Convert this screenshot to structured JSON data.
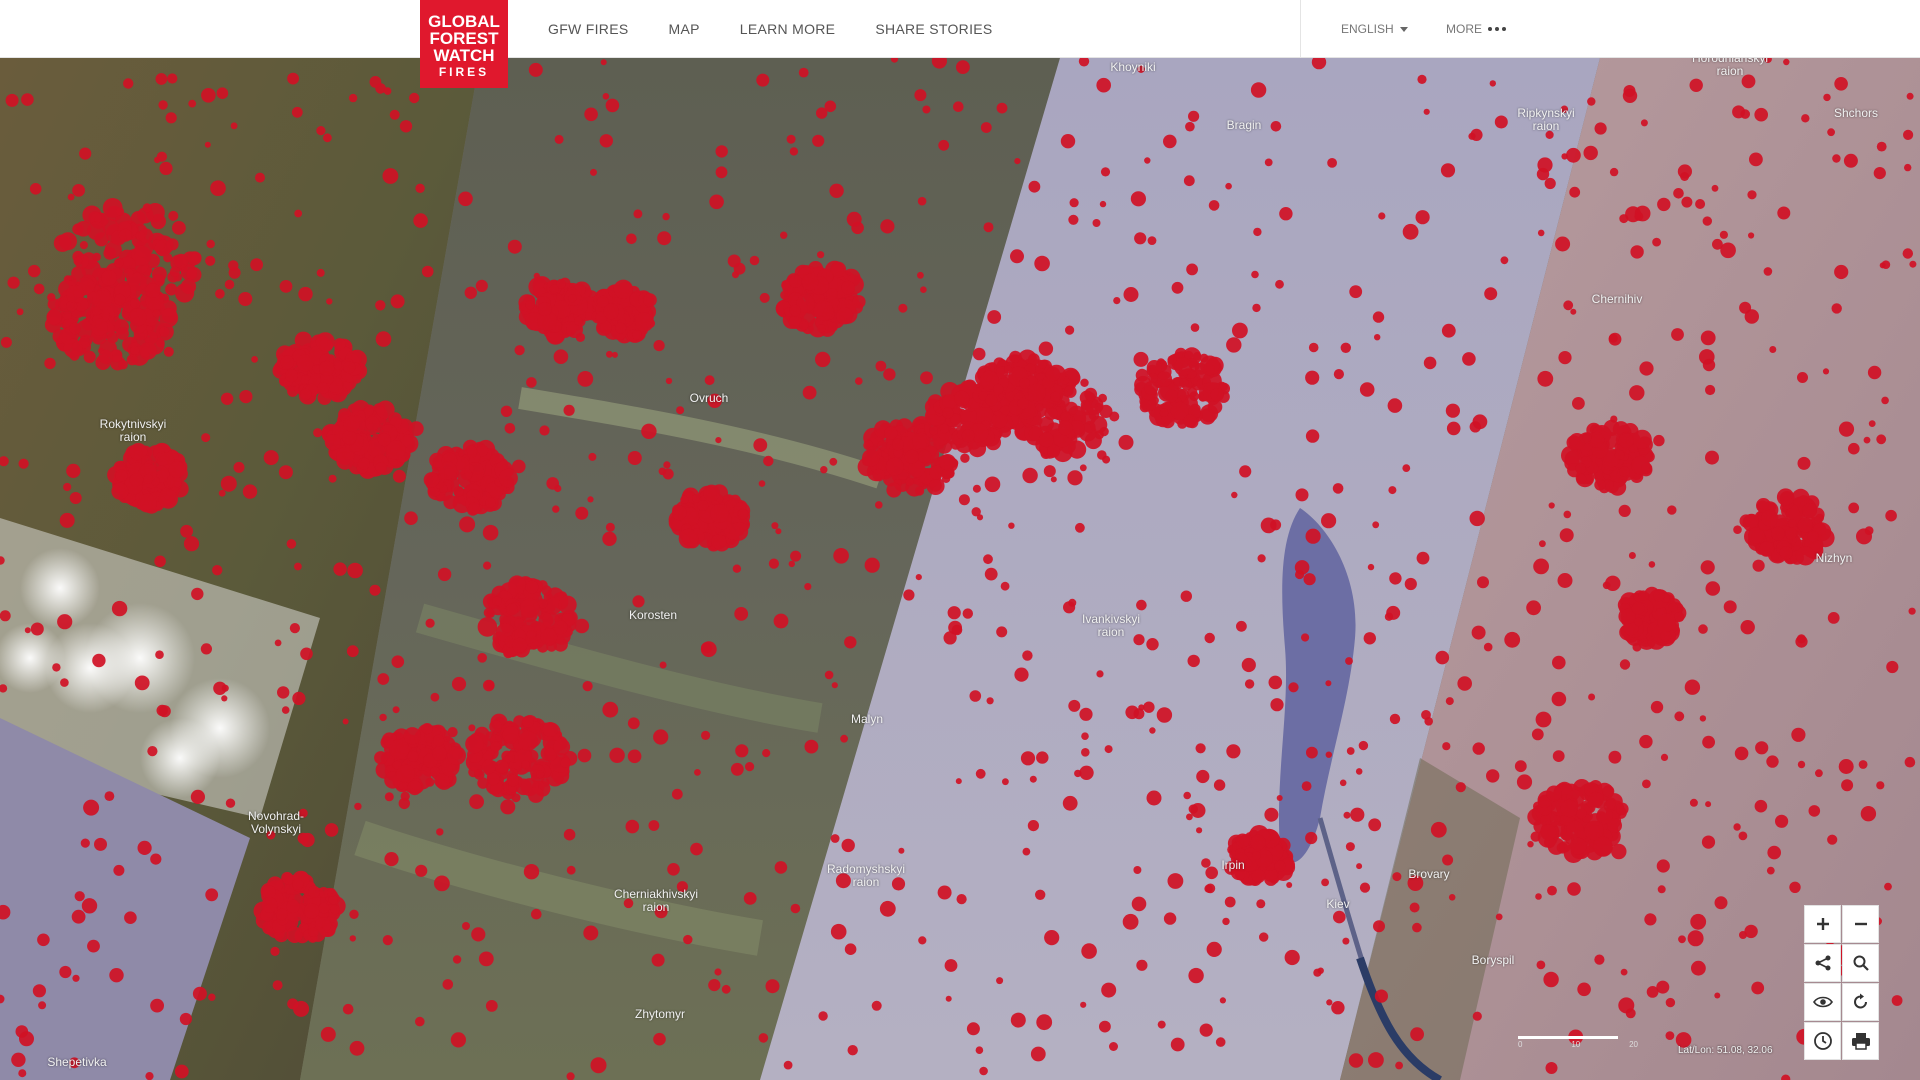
{
  "header": {
    "logo": [
      "GLOBAL",
      "FOREST",
      "WATCH",
      "FIRES"
    ],
    "nav": [
      {
        "label": "GFW FIRES"
      },
      {
        "label": "MAP"
      },
      {
        "label": "LEARN MORE"
      },
      {
        "label": "SHARE STORIES"
      }
    ],
    "language": "ENGLISH",
    "more": "MORE"
  },
  "colors": {
    "brand_red": "#e0182d",
    "fire_red": "#d01125"
  },
  "map_labels": [
    {
      "id": "khoynyky",
      "text": "Khoyniki"
    },
    {
      "id": "bragin",
      "text": "Bragin"
    },
    {
      "id": "horodnianskyi",
      "text": "Horodnianskyi\nraion"
    },
    {
      "id": "ripkynskyi",
      "text": "Ripkynskyi\nraion"
    },
    {
      "id": "shchors",
      "text": "Shchors"
    },
    {
      "id": "chernihiv",
      "text": "Chernihiv"
    },
    {
      "id": "ovruch",
      "text": "Ovruch"
    },
    {
      "id": "rokytnivskyi",
      "text": "Rokytnivskyi\nraion"
    },
    {
      "id": "korosten",
      "text": "Korosten"
    },
    {
      "id": "ivankivskyi",
      "text": "Ivankivskyi\nraion"
    },
    {
      "id": "nizhyn",
      "text": "Nizhyn"
    },
    {
      "id": "malyn",
      "text": "Malyn"
    },
    {
      "id": "novohrad",
      "text": "Novohrad-\nVolynskyi"
    },
    {
      "id": "radomyshskyi",
      "text": "Radomyshskyi\nraion"
    },
    {
      "id": "irpin",
      "text": "Irpin"
    },
    {
      "id": "cherniakhivskyi",
      "text": "Cherniakhivskyi\nraion"
    },
    {
      "id": "kiev",
      "text": "Kiev"
    },
    {
      "id": "brovary",
      "text": "Brovary"
    },
    {
      "id": "boryspil",
      "text": "Boryspil"
    },
    {
      "id": "zhytomyr",
      "text": "Zhytomyr"
    },
    {
      "id": "shepetivka",
      "text": "Shepetivka"
    }
  ],
  "map_controls": [
    {
      "name": "zoom-in",
      "icon": "plus-icon"
    },
    {
      "name": "zoom-out",
      "icon": "minus-icon"
    },
    {
      "name": "share",
      "icon": "share-icon"
    },
    {
      "name": "search",
      "icon": "search-icon"
    },
    {
      "name": "toggle-view",
      "icon": "eye-icon"
    },
    {
      "name": "reset",
      "icon": "refresh-icon"
    },
    {
      "name": "timeline",
      "icon": "clock-icon"
    },
    {
      "name": "print",
      "icon": "print-icon"
    }
  ],
  "scale_bar": {
    "ticks": [
      "0",
      "10",
      "20"
    ]
  },
  "coordinates": "Lat/Lon: 51.08, 32.06"
}
